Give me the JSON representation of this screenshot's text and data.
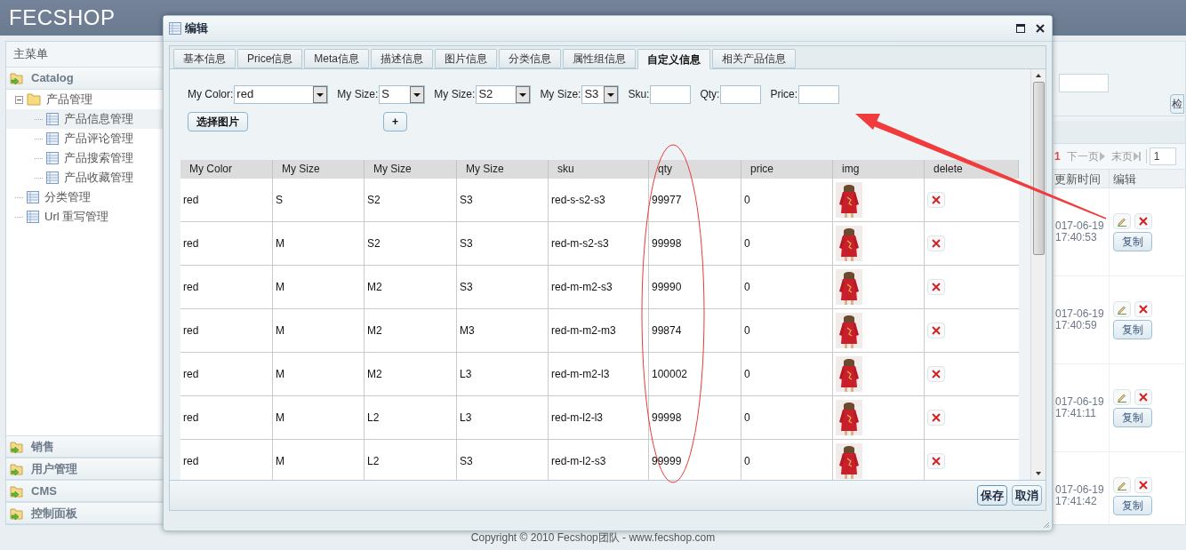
{
  "header": {
    "logo": "FECSHOP"
  },
  "sidebar": {
    "title": "主菜单",
    "sections": [
      {
        "label": "Catalog",
        "expanded": true,
        "tree": [
          {
            "label": "产品管理",
            "kind": "folder",
            "expanded": true,
            "selected": false,
            "children": [
              {
                "label": "产品信息管理",
                "kind": "page",
                "selected": true
              },
              {
                "label": "产品评论管理",
                "kind": "page",
                "selected": false
              },
              {
                "label": "产品搜索管理",
                "kind": "page",
                "selected": false
              },
              {
                "label": "产品收藏管理",
                "kind": "page",
                "selected": false
              }
            ]
          },
          {
            "label": "分类管理",
            "kind": "page",
            "selected": false
          },
          {
            "label": "Url 重写管理",
            "kind": "page",
            "selected": false
          }
        ]
      },
      {
        "label": "销售",
        "expanded": false
      },
      {
        "label": "用户管理",
        "expanded": false
      },
      {
        "label": "CMS",
        "expanded": false
      },
      {
        "label": "控制面板",
        "expanded": false
      }
    ]
  },
  "list_panel": {
    "search_button": "检",
    "pagination": {
      "current": "1",
      "next": "下一页",
      "last": "末页",
      "page_input": "1"
    },
    "columns": [
      "更新时间",
      "编辑"
    ],
    "rows": [
      {
        "date": "017-06-19",
        "time": "17:40:53",
        "copy": "复制"
      },
      {
        "date": "017-06-19",
        "time": "17:40:59",
        "copy": "复制"
      },
      {
        "date": "017-06-19",
        "time": "17:41:11",
        "copy": "复制"
      },
      {
        "date": "017-06-19",
        "time": "17:41:42",
        "copy": "复制"
      }
    ]
  },
  "dialog": {
    "title": "编辑",
    "tabs": [
      {
        "label": "基本信息",
        "selected": false
      },
      {
        "label": "Price信息",
        "selected": false
      },
      {
        "label": "Meta信息",
        "selected": false
      },
      {
        "label": "描述信息",
        "selected": false
      },
      {
        "label": "图片信息",
        "selected": false
      },
      {
        "label": "分类信息",
        "selected": false
      },
      {
        "label": "属性组信息",
        "selected": false
      },
      {
        "label": "自定义信息",
        "selected": true
      },
      {
        "label": "相关产品信息",
        "selected": false
      }
    ],
    "form": [
      {
        "kind": "select",
        "label": "My Color:",
        "value": "red"
      },
      {
        "kind": "select",
        "label": "My Size:",
        "value": "S"
      },
      {
        "kind": "select",
        "label": "My Size:",
        "value": "S2"
      },
      {
        "kind": "select",
        "label": "My Size:",
        "value": "S3"
      },
      {
        "kind": "input",
        "label": "Sku:"
      },
      {
        "kind": "input",
        "label": "Qty:"
      },
      {
        "kind": "input",
        "label": "Price:"
      }
    ],
    "choose_image_button": "选择图片",
    "add_button": "+",
    "table": {
      "columns": [
        "My Color",
        "My Size",
        "My Size",
        "My Size",
        "sku",
        "qty",
        "price",
        "img",
        "delete"
      ],
      "rows": [
        [
          "red",
          "S",
          "S2",
          "S3",
          "red-s-s2-s3",
          "99977",
          "0"
        ],
        [
          "red",
          "M",
          "S2",
          "S3",
          "red-m-s2-s3",
          "99998",
          "0"
        ],
        [
          "red",
          "M",
          "M2",
          "S3",
          "red-m-m2-s3",
          "99990",
          "0"
        ],
        [
          "red",
          "M",
          "M2",
          "M3",
          "red-m-m2-m3",
          "99874",
          "0"
        ],
        [
          "red",
          "M",
          "M2",
          "L3",
          "red-m-m2-l3",
          "100002",
          "0"
        ],
        [
          "red",
          "M",
          "L2",
          "L3",
          "red-m-l2-l3",
          "99998",
          "0"
        ],
        [
          "red",
          "M",
          "L2",
          "S3",
          "red-m-l2-s3",
          "99999",
          "0"
        ]
      ]
    },
    "buttons": [
      "保存",
      "取消"
    ]
  },
  "footer": {
    "copyright": "Copyright © 2010 Fecshop团队 - www.fecshop.com"
  }
}
